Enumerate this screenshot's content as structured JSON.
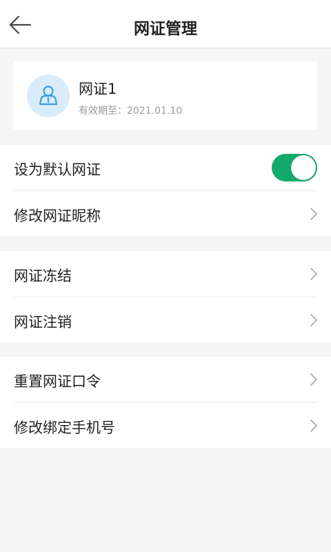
{
  "header": {
    "title": "网证管理",
    "back_icon": "arrow-left-icon"
  },
  "certificate": {
    "name": "网证1",
    "expiry": "有效期至：2021.01.10",
    "avatar_icon": "user-shield-icon",
    "avatar_color": "#3a9be0"
  },
  "settings": {
    "default_cert": {
      "label": "设为默认网证",
      "enabled": true,
      "toggle_color": "#12a96c"
    },
    "rename": {
      "label": "修改网证昵称"
    }
  },
  "status_actions": {
    "freeze": {
      "label": "网证冻结"
    },
    "cancel": {
      "label": "网证注销"
    }
  },
  "security": {
    "reset_password": {
      "label": "重置网证口令"
    },
    "change_phone": {
      "label": "修改绑定手机号"
    }
  }
}
